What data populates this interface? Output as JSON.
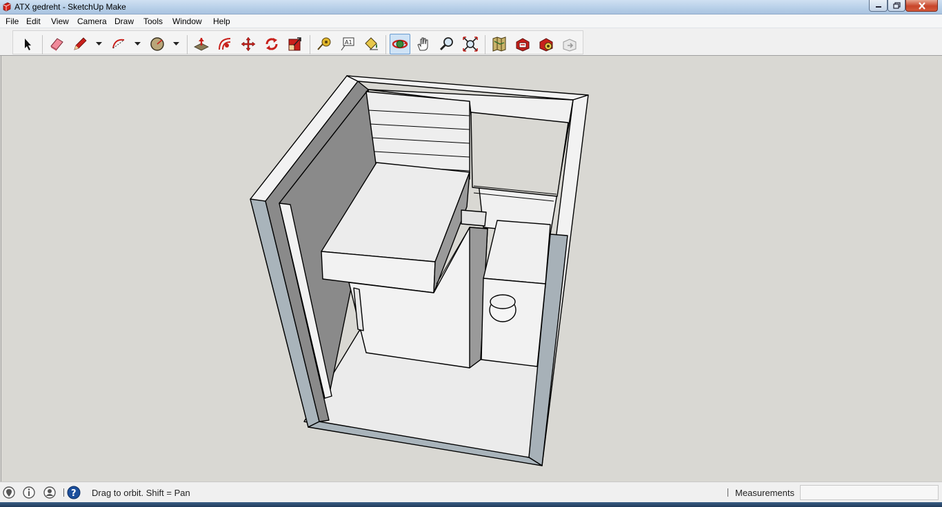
{
  "window": {
    "title": "ATX gedreht - SketchUp Make",
    "app_icon": "sketchup-icon",
    "controls": [
      "minimize-icon",
      "maximize-icon",
      "close-icon"
    ]
  },
  "menu": {
    "items": [
      "File",
      "Edit",
      "View",
      "Camera",
      "Draw",
      "Tools",
      "Window",
      "Help"
    ]
  },
  "toolbar": {
    "tools": [
      {
        "name": "select-tool",
        "icon": "arrow-icon"
      },
      {
        "name": "eraser-tool",
        "icon": "eraser-icon"
      },
      {
        "name": "line-tool",
        "icon": "pencil-icon",
        "dropdown": true
      },
      {
        "name": "arc-tool",
        "icon": "arc-icon",
        "dropdown": true
      },
      {
        "name": "shape-tool",
        "icon": "circle-icon",
        "dropdown": true
      },
      {
        "name": "push-pull-tool",
        "icon": "push-pull-icon"
      },
      {
        "name": "offset-tool",
        "icon": "offset-icon"
      },
      {
        "name": "move-tool",
        "icon": "move-icon"
      },
      {
        "name": "rotate-tool",
        "icon": "rotate-icon"
      },
      {
        "name": "scale-tool",
        "icon": "scale-icon"
      },
      {
        "name": "tape-measure-tool",
        "icon": "tape-icon"
      },
      {
        "name": "text-tool",
        "icon": "text-icon",
        "label": "A1"
      },
      {
        "name": "paint-bucket-tool",
        "icon": "paint-bucket-icon"
      },
      {
        "name": "orbit-tool",
        "icon": "orbit-icon",
        "active": true
      },
      {
        "name": "pan-tool",
        "icon": "hand-icon"
      },
      {
        "name": "zoom-tool",
        "icon": "magnifier-icon"
      },
      {
        "name": "zoom-extents-tool",
        "icon": "zoom-extents-icon"
      },
      {
        "name": "add-location-tool",
        "icon": "map-icon"
      },
      {
        "name": "warehouse-tool",
        "icon": "warehouse-icon"
      },
      {
        "name": "extension-warehouse-tool",
        "icon": "extension-icon"
      },
      {
        "name": "share-model-tool",
        "icon": "share-icon"
      }
    ]
  },
  "status": {
    "icons": [
      "geo-location-icon",
      "credits-icon",
      "account-icon",
      "help-icon"
    ],
    "message": "Drag to orbit.  Shift = Pan",
    "measurements_label": "Measurements",
    "measurements_value": ""
  },
  "colors": {
    "viewport_bg": "#d9d8d3",
    "face_front": "#f2f2f2",
    "face_back": "#a7b1b8",
    "face_shadow": "#8a8a8a",
    "accent_red": "#c8201b"
  }
}
